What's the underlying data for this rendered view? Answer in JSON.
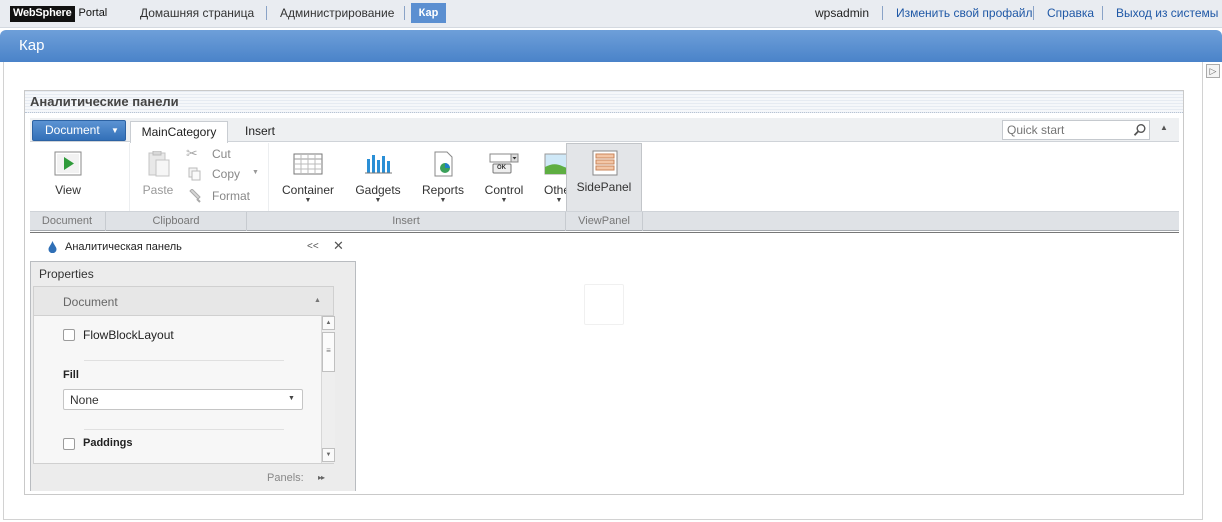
{
  "topbar": {
    "logo_brand": "WebSphere",
    "logo_product": "Portal",
    "nav": [
      "Домашняя страница",
      "Администрирование",
      "Кар"
    ],
    "user": "wpsadmin",
    "links": [
      "Изменить свой профайл",
      "Справка",
      "Выход из системы"
    ]
  },
  "page": {
    "title": "Кар",
    "side_toggle_icon": "expand-right-icon"
  },
  "portlet": {
    "title": "Аналитические панели"
  },
  "ribbon": {
    "document_button": "Document",
    "tabs": [
      "MainCategory",
      "Insert"
    ],
    "active_tab": "MainCategory",
    "quick_start_placeholder": "Quick start",
    "buttons": {
      "view": "View",
      "paste": "Paste",
      "cut": "Cut",
      "copy": "Copy",
      "format": "Format",
      "container": "Container",
      "gadgets": "Gadgets",
      "reports": "Reports",
      "control": "Control",
      "other": "Other",
      "sidepanel": "SidePanel",
      "control_icon_text": "OK"
    },
    "groups": [
      "Document",
      "Clipboard",
      "Insert",
      "ViewPanel"
    ]
  },
  "panel": {
    "tab_title": "Аналитическая панель",
    "collapse_glyph": "<<",
    "close_glyph": "✕"
  },
  "properties": {
    "title": "Properties",
    "section": "Document",
    "flow_block_layout": "FlowBlockLayout",
    "fill_label": "Fill",
    "fill_value": "None",
    "paddings": "Paddings",
    "footer": "Panels:",
    "footer_arrows": "▸▸"
  },
  "colors": {
    "accent": "#4a83c9",
    "active_nav": "#5b8fd1",
    "link": "#1f58a6"
  }
}
